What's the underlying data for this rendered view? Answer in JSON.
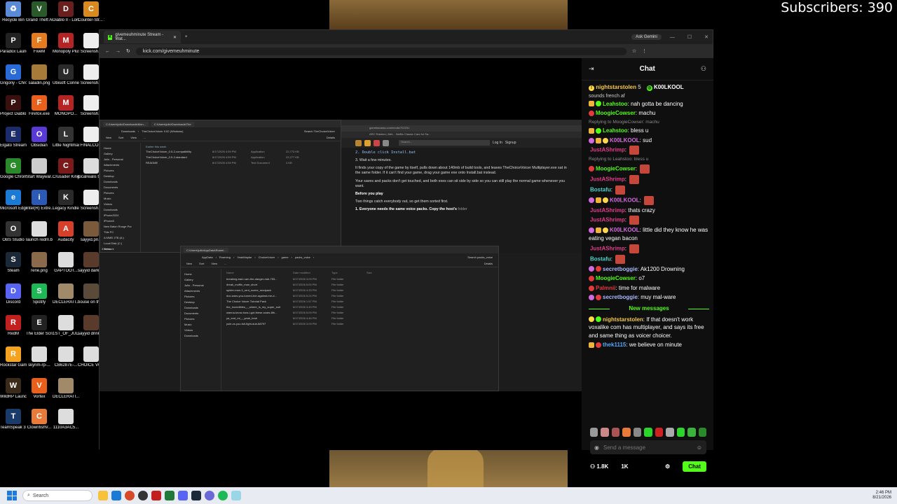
{
  "overlay": {
    "subscribers": "Subscribers: 390"
  },
  "desktop_icons": [
    {
      "label": "Recycle Bin",
      "color": "#5b8bd6",
      "glyph": "♻"
    },
    {
      "label": "Grand Theft Auto V La...",
      "color": "#2a5a2a",
      "glyph": "V"
    },
    {
      "label": "Diablo II - Lord of D...",
      "color": "#6a1f1f",
      "glyph": "D"
    },
    {
      "label": "Counter-Str... 2",
      "color": "#d88a20",
      "glyph": "C"
    },
    {
      "label": "Paradox Launcher v2",
      "color": "#222",
      "glyph": "P"
    },
    {
      "label": "FiveM",
      "color": "#e67a1f",
      "glyph": "F"
    },
    {
      "label": "Monopoly Plus",
      "color": "#b52424",
      "glyph": "M"
    },
    {
      "label": "Screensh...",
      "color": "#eee",
      "glyph": ""
    },
    {
      "label": "Grigoriy - Chrome",
      "color": "#2a6ad6",
      "glyph": "G"
    },
    {
      "label": "saladin.png",
      "color": "#a87a3a",
      "glyph": ""
    },
    {
      "label": "Ubisoft Connect",
      "color": "#2a2a2a",
      "glyph": "U"
    },
    {
      "label": "Screensh...",
      "color": "#eee",
      "glyph": ""
    },
    {
      "label": "Project Diablo 2",
      "color": "#3a0f0f",
      "glyph": "P"
    },
    {
      "label": "Firefox.exe",
      "color": "#e8601c",
      "glyph": "F"
    },
    {
      "label": "MONOPO...",
      "color": "#b52424",
      "glyph": "M"
    },
    {
      "label": "Screensh...",
      "color": "#eee",
      "glyph": ""
    },
    {
      "label": "Elgato Stream Deck",
      "color": "#1c2c6a",
      "glyph": "E"
    },
    {
      "label": "Obsidian",
      "color": "#5a3ad6",
      "glyph": "O"
    },
    {
      "label": "Little Nightmar...",
      "color": "#333",
      "glyph": "L"
    },
    {
      "label": "FINALCO...",
      "color": "#eee",
      "glyph": ""
    },
    {
      "label": "Google Chrome",
      "color": "#2a8a2a",
      "glyph": "G"
    },
    {
      "label": "Start Waywar...",
      "color": "#ccc",
      "glyph": ""
    },
    {
      "label": "Crusader Kings III",
      "color": "#7a1a1a",
      "glyph": "C"
    },
    {
      "label": "localrealis ticket.pn...",
      "color": "#ddd",
      "glyph": ""
    },
    {
      "label": "Microsoft Edge",
      "color": "#1a7ad6",
      "glyph": "e"
    },
    {
      "label": "Intel(R) Extre...",
      "color": "#2a5ab6",
      "glyph": "i"
    },
    {
      "label": "Legacy Kindle",
      "color": "#2a2a2a",
      "glyph": "K"
    },
    {
      "label": "Screensh...",
      "color": "#eee",
      "glyph": ""
    },
    {
      "label": "OBS Studio",
      "color": "#333",
      "glyph": "O"
    },
    {
      "label": "launch redm.bat",
      "color": "#ddd",
      "glyph": ""
    },
    {
      "label": "Audacity",
      "color": "#d6402a",
      "glyph": "A"
    },
    {
      "label": "sayyid.pn...",
      "color": "#7a5a3a",
      "glyph": ""
    },
    {
      "label": "Steam",
      "color": "#1b2838",
      "glyph": "S"
    },
    {
      "label": "rene.png",
      "color": "#8a6a4a",
      "glyph": ""
    },
    {
      "label": "GAPTOOT...",
      "color": "#ddd",
      "glyph": ""
    },
    {
      "label": "sayyid darker.pn...",
      "color": "#5a3a2a",
      "glyph": ""
    },
    {
      "label": "Discord",
      "color": "#5865f2",
      "glyph": "D"
    },
    {
      "label": "Spotify",
      "color": "#1db954",
      "glyph": "S"
    },
    {
      "label": "DECLERATI...",
      "color": "#a08a6a",
      "glyph": ""
    },
    {
      "label": "house on the p...",
      "color": "#5a4a3a",
      "glyph": ""
    },
    {
      "label": "RedM",
      "color": "#c21f1f",
      "glyph": "R"
    },
    {
      "label": "The Elder Scrolls ...",
      "color": "#222",
      "glyph": "E"
    },
    {
      "label": "1ST_OF_JUL...",
      "color": "#ddd",
      "glyph": ""
    },
    {
      "label": "sayyid drinking...",
      "color": "#5a3a2a",
      "glyph": ""
    },
    {
      "label": "Rockstar Games ...",
      "color": "#f5a31f",
      "glyph": "R"
    },
    {
      "label": "skyrim-rp-...",
      "color": "#ddd",
      "glyph": ""
    },
    {
      "label": "CB6287E-...",
      "color": "#ddd",
      "glyph": ""
    },
    {
      "label": "CHOICE VOICE...",
      "color": "#ddd",
      "glyph": ""
    },
    {
      "label": "WildRP Launcher",
      "color": "#3a2a1a",
      "glyph": "W"
    },
    {
      "label": "Vortex",
      "color": "#e8601c",
      "glyph": "V"
    },
    {
      "label": "DECLERATI... FINAL.png",
      "color": "#a08a6a",
      "glyph": ""
    },
    {
      "label": "",
      "color": "transparent",
      "glyph": ""
    },
    {
      "label": "TeamSpeak 3 Client",
      "color": "#1a3a6a",
      "glyph": "T"
    },
    {
      "label": "ClownfishV...",
      "color": "#e87a3a",
      "glyph": "C"
    },
    {
      "label": "1110A3AC5...",
      "color": "#ddd",
      "glyph": ""
    }
  ],
  "browser": {
    "tab_title": "givemeuhminute Stream - Wat...",
    "new_tab": "+",
    "ask_gemini": "Ask Gemini",
    "url": "kick.com/givemeuhminute",
    "min": "—",
    "max": "☐",
    "close": "✕"
  },
  "explorer_top": {
    "tab1": "C:\\Users\\julio\\Downloads\\Mon...",
    "tab2": "C:\\Users\\julio\\Downloads\\The",
    "path": [
      "Downloads",
      "TheChoiceVoicer 0.52 (Windows)"
    ],
    "search": "Search TheChoiceVoicer",
    "toolbar": [
      "New",
      "Sort",
      "View",
      "...",
      "Details"
    ],
    "nav": [
      "Home",
      "Gallery",
      "Julio - Personal",
      "Attachments",
      "Pictures",
      "Desktop",
      "Downloads",
      "Documents",
      "Pictures",
      "Music",
      "Videos",
      "Downloads",
      "iPhone2024",
      "iPhone8",
      "New Baton Rouge Por",
      "This PC",
      "A MMB 1TB (A:)",
      "Local Disk (C:)",
      "Network"
    ],
    "section": "Earlier this week",
    "columns": [
      "Name",
      "Date modified",
      "Type",
      "Size"
    ],
    "rows": [
      {
        "name": "TheChoiceVoicer_0.5-2-compatibility",
        "date": "8/17/2026 4:59 PM",
        "type": "Application",
        "size": "22,773 KB"
      },
      {
        "name": "TheChoiceVoicer_0.5-2-standard",
        "date": "8/17/2026 4:59 PM",
        "type": "Application",
        "size": "22,277 KB"
      },
      {
        "name": "README",
        "date": "8/17/2026 4:59 PM",
        "type": "Text Document",
        "size": "4 KB"
      }
    ],
    "status": "3 items"
  },
  "explorer_bottom": {
    "tab": "C:\\Users\\julio\\AppData\\Roami...",
    "path": [
      "AppData",
      "Roaming",
      "YeahMaybe",
      "ChoiceVoicer",
      "game",
      "packs_voice"
    ],
    "search": "Search packs_voice",
    "toolbar": [
      "New",
      "Sort",
      "View",
      "...",
      "Details"
    ],
    "nav": [
      "Home",
      "Gallery",
      "Julio - Personal",
      "Attachments",
      "Pictures",
      "Desktop",
      "Downloads",
      "Documents",
      "Pictures",
      "Music",
      "Videos",
      "Downloads"
    ],
    "columns": [
      "Name",
      "Date modified",
      "Type",
      "Size"
    ],
    "rows": [
      {
        "name": "breaking-bad-i-am-the-danger-dub-753...",
        "date": "8/17/2026 3:09 PM",
        "type": "File folder"
      },
      {
        "name": "dreak_muffin_man_short",
        "date": "8/17/2026 5:00 PM",
        "type": "File folder"
      },
      {
        "name": "spider-man-3_rent_scene_modpack",
        "date": "8/17/2026 4:33 PM",
        "type": "File folder"
      },
      {
        "name": "doc-wars-you-turned-her-against-me-d...",
        "date": "8/17/2026 5:24 PM",
        "type": "File folder"
      },
      {
        "name": "The Choice Voicer Tutorial Pack",
        "date": "8/17/2026 1:57 PM",
        "type": "File folder"
      },
      {
        "name": "the_incredibles_-_where_is_my_super_suit",
        "date": "8/17/2026 3:49 PM",
        "type": "File folder"
      },
      {
        "name": "wanna-know-how-i-got-these-scars-8th...",
        "date": "8/17/2026 5:09 PM",
        "type": "File folder"
      },
      {
        "name": "ya_end_mi_-_yeah_bruh",
        "date": "8/17/2026 4:46 PM",
        "type": "File folder"
      },
      {
        "name": "yule-vs-you-full-fight-dub-88797",
        "date": "8/17/2026 3:09 PM",
        "type": "File folder"
      }
    ]
  },
  "gamebanana": {
    "url": "gamebanana.com/mods/702231",
    "login": "Log In",
    "signup": "Signup",
    "search": "Search...",
    "bookmarks": "ARC Raiders | Met...   Netflix   Classic Cars for Sa...",
    "lines": [
      "2. Double click Install.bat",
      "3. Wait a few minutes.",
      "It finds your copy of the game by itself, pulls down about 140mb of build tools, and leaves TheChoiceVoicer Multiplayer.exe sat in the same folder. If it can't find your game, drag your game exe onto Install.bat instead.",
      "Your saves and packs don't get touched, and both exes can sit side by side so you can still play the normal game whenever you want.",
      "Before you play",
      "Two things catch everybody out, so get them sorted first.",
      "1. Everyone needs the same voice packs. Copy the host's"
    ],
    "folder_word": "folder"
  },
  "chat": {
    "title": "Chat",
    "pinned": [
      {
        "user": "nightstarstolen",
        "extra": "5"
      },
      {
        "user": "K00LKOOL",
        "extra": ""
      }
    ],
    "partial": "sounds french af",
    "messages": [
      {
        "badges": [
          "crown",
          "mod"
        ],
        "user": "Leahstoo",
        "color": "#53fc18",
        "text": "nah gotta be dancing",
        "emote": false
      },
      {
        "badges": [
          "red"
        ],
        "user": "MoogieCowser",
        "color": "#53fc18",
        "text": "machu",
        "emote": false
      },
      {
        "reply": "Replying to MoogieCowser: machu"
      },
      {
        "badges": [
          "crown",
          "mod"
        ],
        "user": "Leahstoo",
        "color": "#53fc18",
        "text": "bless u",
        "emote": false
      },
      {
        "badges": [
          "sub",
          "crown",
          "og"
        ],
        "user": "K00LKOOL",
        "color": "#d46ae0",
        "text": "sud",
        "emote": false
      },
      {
        "badges": [],
        "user": "JustAShrimp",
        "color": "#e23b8a",
        "text": "",
        "emote": true
      },
      {
        "reply": "Replying to Leahstoo: bless u"
      },
      {
        "badges": [
          "red"
        ],
        "user": "MoogieCowser",
        "color": "#53fc18",
        "text": "",
        "emote": true
      },
      {
        "badges": [],
        "user": "JustAShrimp",
        "color": "#e23b8a",
        "text": "",
        "emote": true
      },
      {
        "badges": [],
        "user": "Bostafu",
        "color": "#4ad1c8",
        "text": "",
        "emote": true
      },
      {
        "badges": [
          "sub",
          "crown",
          "og"
        ],
        "user": "K00LKOOL",
        "color": "#d46ae0",
        "text": "",
        "emote": true
      },
      {
        "badges": [],
        "user": "JustAShrimp",
        "color": "#e23b8a",
        "text": "thats crazy",
        "emote": false
      },
      {
        "badges": [],
        "user": "JustAShrimp",
        "color": "#e23b8a",
        "text": "",
        "emote": true
      },
      {
        "badges": [
          "sub",
          "crown",
          "og"
        ],
        "user": "K00LKOOL",
        "color": "#d46ae0",
        "text": "little did they know he was eating vegan bacon",
        "emote": false
      },
      {
        "badges": [],
        "user": "JustAShrimp",
        "color": "#e23b8a",
        "text": "",
        "emote": true
      },
      {
        "badges": [],
        "user": "Bostafu",
        "color": "#4ad1c8",
        "text": "",
        "emote": true
      },
      {
        "badges": [
          "sub",
          "red"
        ],
        "user": "secretboggie",
        "color": "#a8b8ff",
        "text": "Ak1200 Drowning",
        "emote": false
      },
      {
        "badges": [
          "red"
        ],
        "user": "MoogieCowser",
        "color": "#53fc18",
        "text": "o7",
        "emote": false
      },
      {
        "badges": [
          "red"
        ],
        "user": "Palmnii",
        "color": "#e23b3b",
        "text": "time for malware",
        "emote": false
      },
      {
        "badges": [
          "sub",
          "red"
        ],
        "user": "secretboggie",
        "color": "#a8b8ff",
        "text": "muy mal-ware",
        "emote": false
      }
    ],
    "new_messages": "New messages",
    "after": [
      {
        "badges": [
          "og",
          "mod"
        ],
        "user": "nightstarstolen",
        "color": "#f5c84a",
        "text": "If that doesn't work voxalike com has multiplayer, and says its free and same thing as voicer choicer."
      },
      {
        "badges": [
          "crown",
          "red"
        ],
        "user": "thek1115",
        "color": "#53a8fc",
        "text": "we believe on minute"
      }
    ],
    "send_placeholder": "Send a message",
    "viewers": "1.8K",
    "followers": "1K",
    "chat_button": "Chat"
  },
  "taskbar": {
    "search": "Search",
    "time": "2:46 PM",
    "date": "8/21/2026"
  }
}
